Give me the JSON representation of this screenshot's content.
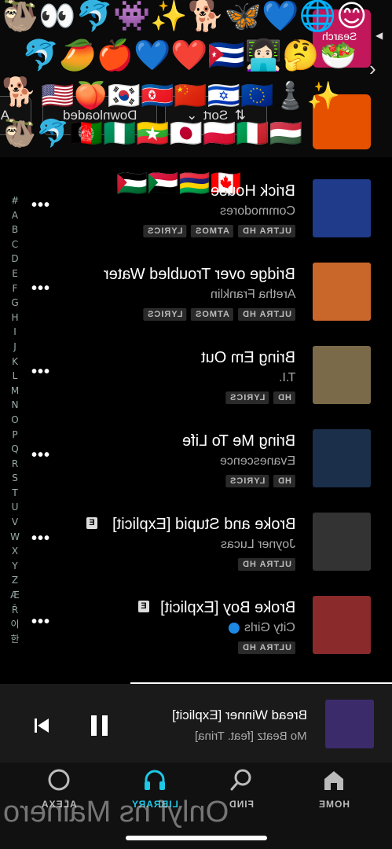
{
  "overlay": {
    "emoji_row1": "🦥👀🐬👾✨🐕🦋💙🌐😊",
    "emoji_row2": "🐬🥭🍎💙❤️🇨🇺👩🏻‍💻🤔🥗",
    "emoji_row3": "🇺🇸🍑🇰🇷🇰🇵🇨🇳🇮🇱🇪🇺♟️✨",
    "emoji_row4": "🦥🐬🇦🇫🇳🇬🇲🇲🇯🇵🇵🇱🇮🇹🇭🇺",
    "dog_emoji": "🐕"
  },
  "header": {
    "search_label": "Search",
    "filter_downloaded": "Downloaded",
    "sort_label": "Sort",
    "chip_a": "Al"
  },
  "alphabet_index": [
    "#",
    "A",
    "B",
    "C",
    "D",
    "E",
    "F",
    "G",
    "H",
    "I",
    "J",
    "K",
    "L",
    "M",
    "N",
    "O",
    "P",
    "Q",
    "R",
    "S",
    "T",
    "U",
    "V",
    "W",
    "X",
    "Y",
    "Z",
    "Æ",
    "Ř",
    "이",
    "한"
  ],
  "flags_overlay": "🇵🇸🇸🇩🇲🇺🇨🇦",
  "tracks": [
    {
      "title": "Brick House",
      "artist": "Commodores",
      "tags": [
        "ULTRA HD",
        "ATMOS",
        "LYRICS"
      ],
      "explicit": false,
      "downloaded": false,
      "art_color": "#1f3b8a"
    },
    {
      "title": "Bridge over Troubled Water",
      "artist": "Aretha Franklin",
      "tags": [
        "ULTRA HD",
        "ATMOS",
        "LYRICS"
      ],
      "explicit": false,
      "downloaded": false,
      "art_color": "#c9662a"
    },
    {
      "title": "Bring Em Out",
      "artist": "T.I.",
      "tags": [
        "HD",
        "LYRICS"
      ],
      "explicit": false,
      "downloaded": false,
      "art_color": "#7a6a4a"
    },
    {
      "title": "Bring Me To Life",
      "artist": "Evanescence",
      "tags": [
        "HD",
        "LYRICS"
      ],
      "explicit": false,
      "downloaded": false,
      "art_color": "#1c2f4a"
    },
    {
      "title": "Broke and Stupid [Explicit]",
      "artist": "Joyner Lucas",
      "tags": [
        "ULTRA HD"
      ],
      "explicit": true,
      "downloaded": false,
      "art_color": "#333333"
    },
    {
      "title": "Broke Boy [Explicit]",
      "artist": "City Girls",
      "tags": [
        "ULTRA HD"
      ],
      "explicit": true,
      "downloaded": true,
      "art_color": "#8a2a2a"
    }
  ],
  "explicit_badge": "E",
  "more_label": "•••",
  "now_playing": {
    "title": "Bread Winner [Explicit]",
    "artist": "Mo Beatz [feat. Trina]"
  },
  "nav": {
    "home": "HOME",
    "find": "FIND",
    "library": "LIBRARY",
    "alexa": "ALEXA",
    "active_color": "#1ec8e6"
  },
  "watermark": "Onlyf ns Mainero"
}
